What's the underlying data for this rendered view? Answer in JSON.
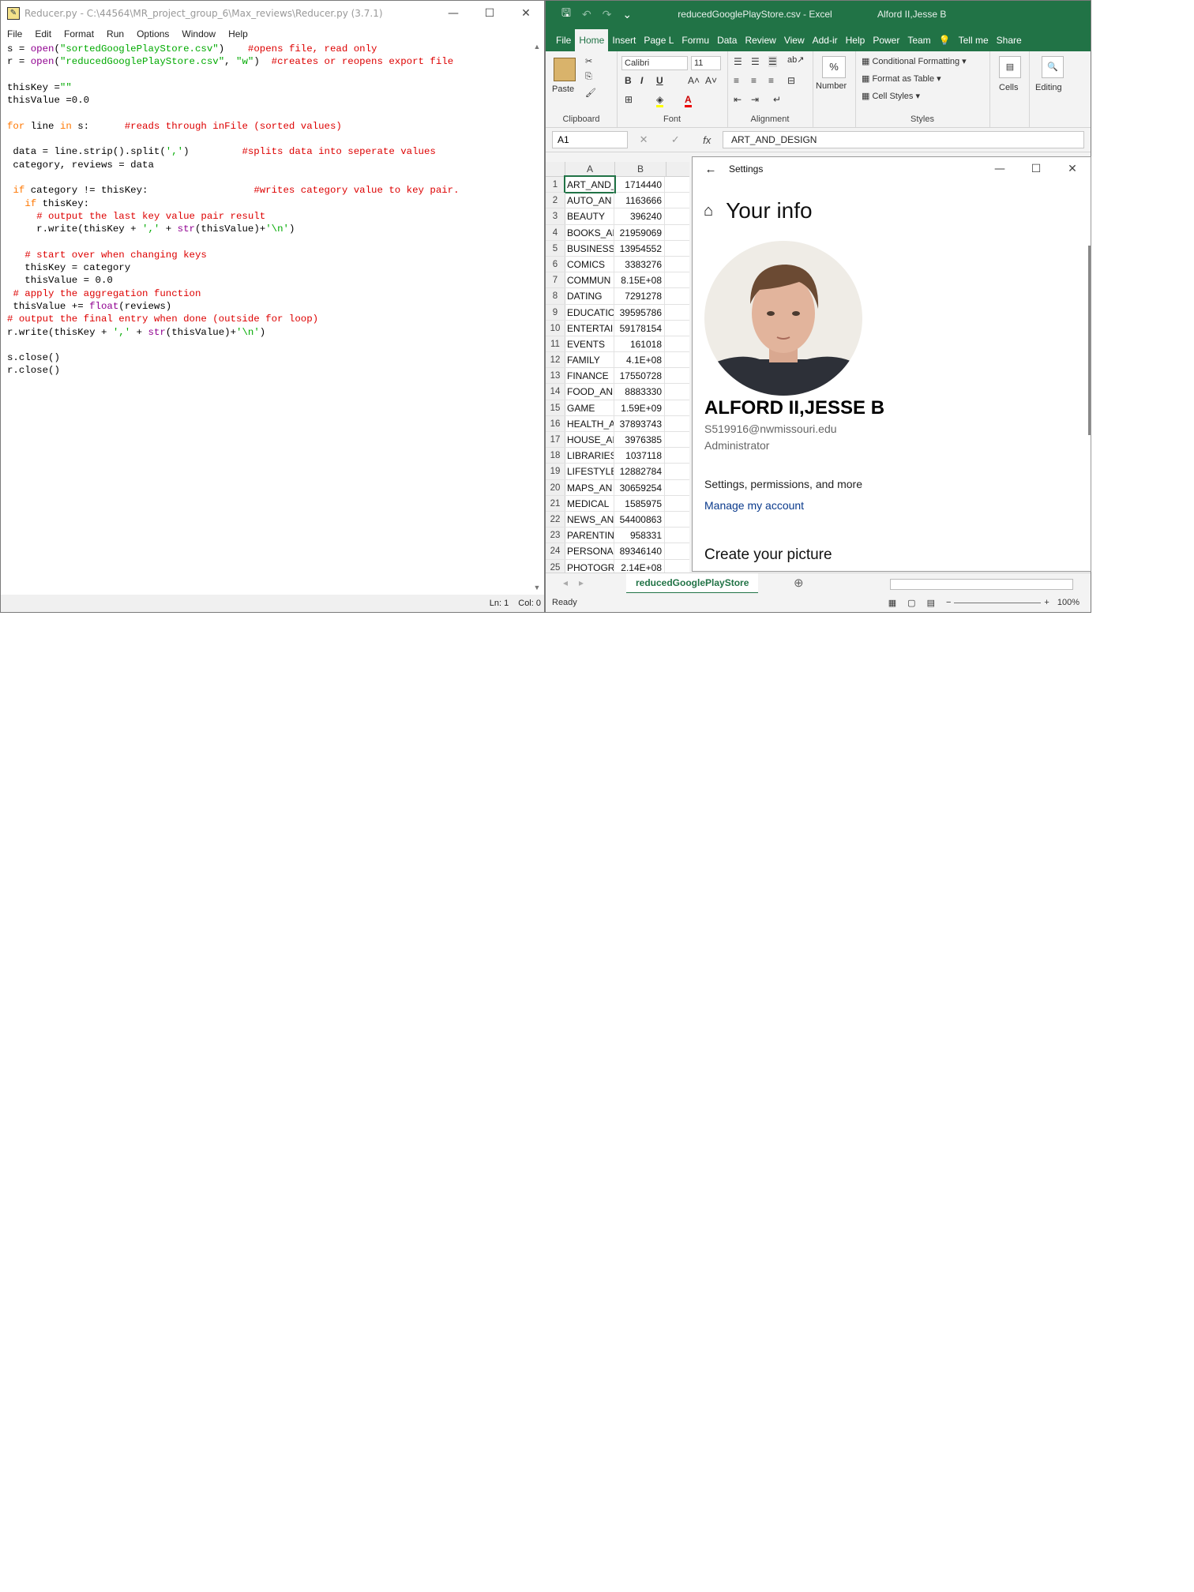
{
  "idle": {
    "title": "Reducer.py - C:\\44564\\MR_project_group_6\\Max_reviews\\Reducer.py (3.7.1)",
    "menu": [
      "File",
      "Edit",
      "Format",
      "Run",
      "Options",
      "Window",
      "Help"
    ],
    "status": {
      "line": "Ln: 1",
      "col": "Col: 0"
    },
    "code_lines": [
      [
        {
          "t": "s = "
        },
        {
          "t": "open",
          "c": "bi"
        },
        {
          "t": "("
        },
        {
          "t": "\"sortedGooglePlayStore.csv\"",
          "c": "str"
        },
        {
          "t": ")    "
        },
        {
          "t": "#opens file, read only",
          "c": "cmt"
        }
      ],
      [
        {
          "t": "r = "
        },
        {
          "t": "open",
          "c": "bi"
        },
        {
          "t": "("
        },
        {
          "t": "\"reducedGooglePlayStore.csv\"",
          "c": "str"
        },
        {
          "t": ", "
        },
        {
          "t": "\"w\"",
          "c": "str"
        },
        {
          "t": ")  "
        },
        {
          "t": "#creates or reopens export file",
          "c": "cmt"
        }
      ],
      [
        {
          "t": ""
        }
      ],
      [
        {
          "t": "thisKey ="
        },
        {
          "t": "\"\"",
          "c": "str"
        }
      ],
      [
        {
          "t": "thisValue =0.0"
        }
      ],
      [
        {
          "t": ""
        }
      ],
      [
        {
          "t": "for",
          "c": "kw"
        },
        {
          "t": " line "
        },
        {
          "t": "in",
          "c": "kw"
        },
        {
          "t": " s:      "
        },
        {
          "t": "#reads through inFile (sorted values)",
          "c": "cmt"
        }
      ],
      [
        {
          "t": ""
        }
      ],
      [
        {
          "t": " data = line.strip().split("
        },
        {
          "t": "','",
          "c": "str"
        },
        {
          "t": ")         "
        },
        {
          "t": "#splits data into seperate values",
          "c": "cmt"
        }
      ],
      [
        {
          "t": " category, reviews = data"
        }
      ],
      [
        {
          "t": ""
        }
      ],
      [
        {
          "t": " "
        },
        {
          "t": "if",
          "c": "kw"
        },
        {
          "t": " category != thisKey:                  "
        },
        {
          "t": "#writes category value to key pair.",
          "c": "cmt"
        }
      ],
      [
        {
          "t": "   "
        },
        {
          "t": "if",
          "c": "kw"
        },
        {
          "t": " thisKey:"
        }
      ],
      [
        {
          "t": "     "
        },
        {
          "t": "# output the last key value pair result",
          "c": "cmt"
        }
      ],
      [
        {
          "t": "     r.write(thisKey + "
        },
        {
          "t": "','",
          "c": "str"
        },
        {
          "t": " + "
        },
        {
          "t": "str",
          "c": "bi"
        },
        {
          "t": "(thisValue)+"
        },
        {
          "t": "'\\n'",
          "c": "str"
        },
        {
          "t": ")"
        }
      ],
      [
        {
          "t": ""
        }
      ],
      [
        {
          "t": "   "
        },
        {
          "t": "# start over when changing keys",
          "c": "cmt"
        }
      ],
      [
        {
          "t": "   thisKey = category"
        }
      ],
      [
        {
          "t": "   thisValue = 0.0"
        }
      ],
      [
        {
          "t": " "
        },
        {
          "t": "# apply the aggregation function",
          "c": "cmt"
        }
      ],
      [
        {
          "t": " thisValue += "
        },
        {
          "t": "float",
          "c": "bi"
        },
        {
          "t": "(reviews)"
        }
      ],
      [
        {
          "t": "# output the final entry when done (outside for loop)",
          "c": "cmt"
        }
      ],
      [
        {
          "t": "r.write(thisKey + "
        },
        {
          "t": "','",
          "c": "str"
        },
        {
          "t": " + "
        },
        {
          "t": "str",
          "c": "bi"
        },
        {
          "t": "(thisValue)+"
        },
        {
          "t": "'\\n'",
          "c": "str"
        },
        {
          "t": ")"
        }
      ],
      [
        {
          "t": ""
        }
      ],
      [
        {
          "t": "s.close()"
        }
      ],
      [
        {
          "t": "r.close()"
        }
      ]
    ]
  },
  "excel": {
    "doc_title": "reducedGooglePlayStore.csv  -  Excel",
    "user": "Alford II,Jesse B",
    "tabs": [
      "File",
      "Home",
      "Insert",
      "Page L",
      "Formu",
      "Data",
      "Review",
      "View",
      "Add-ir",
      "Help",
      "Power",
      "Team"
    ],
    "tell_me": "Tell me",
    "share": "Share",
    "ribbon": {
      "paste": "Paste",
      "clipboard": "Clipboard",
      "font_name": "Calibri",
      "font_size": "11",
      "font_group": "Font",
      "alignment": "Alignment",
      "number": "Number",
      "percent": "%",
      "conditional": "Conditional Formatting",
      "format_table": "Format as Table",
      "cell_styles": "Cell Styles",
      "styles": "Styles",
      "cells": "Cells",
      "editing": "Editing"
    },
    "name_box": "A1",
    "fx": "fx",
    "formula_value": "ART_AND_DESIGN",
    "col_headers": [
      "A",
      "B"
    ],
    "rows": [
      [
        "1",
        "ART_AND_",
        "1714440"
      ],
      [
        "2",
        "AUTO_AN",
        "1163666"
      ],
      [
        "3",
        "BEAUTY",
        "396240"
      ],
      [
        "4",
        "BOOKS_AI",
        "21959069"
      ],
      [
        "5",
        "BUSINESS",
        "13954552"
      ],
      [
        "6",
        "COMICS",
        "3383276"
      ],
      [
        "7",
        "COMMUN",
        "8.15E+08"
      ],
      [
        "8",
        "DATING",
        "7291278"
      ],
      [
        "9",
        "EDUCATIC",
        "39595786"
      ],
      [
        "10",
        "ENTERTAII",
        "59178154"
      ],
      [
        "11",
        "EVENTS",
        "161018"
      ],
      [
        "12",
        "FAMILY",
        "4.1E+08"
      ],
      [
        "13",
        "FINANCE",
        "17550728"
      ],
      [
        "14",
        "FOOD_AN",
        "8883330"
      ],
      [
        "15",
        "GAME",
        "1.59E+09"
      ],
      [
        "16",
        "HEALTH_A",
        "37893743"
      ],
      [
        "17",
        "HOUSE_AI",
        "3976385"
      ],
      [
        "18",
        "LIBRARIES",
        "1037118"
      ],
      [
        "19",
        "LIFESTYLE",
        "12882784"
      ],
      [
        "20",
        "MAPS_AN",
        "30659254"
      ],
      [
        "21",
        "MEDICAL",
        "1585975"
      ],
      [
        "22",
        "NEWS_AN",
        "54400863"
      ],
      [
        "23",
        "PARENTIN",
        "958331"
      ],
      [
        "24",
        "PERSONAI",
        "89346140"
      ],
      [
        "25",
        "PHOTOGR",
        "2.14E+08"
      ]
    ],
    "sheet_tab": "reducedGooglePlayStore",
    "status": "Ready",
    "zoom": "100%"
  },
  "settings": {
    "window_title": "Settings",
    "heading": "Your info",
    "name": "ALFORD II,JESSE B",
    "email": "S519916@nwmissouri.edu",
    "role": "Administrator",
    "permissions": "Settings, permissions, and more",
    "manage_link": "Manage my account",
    "create_picture": "Create your picture"
  }
}
